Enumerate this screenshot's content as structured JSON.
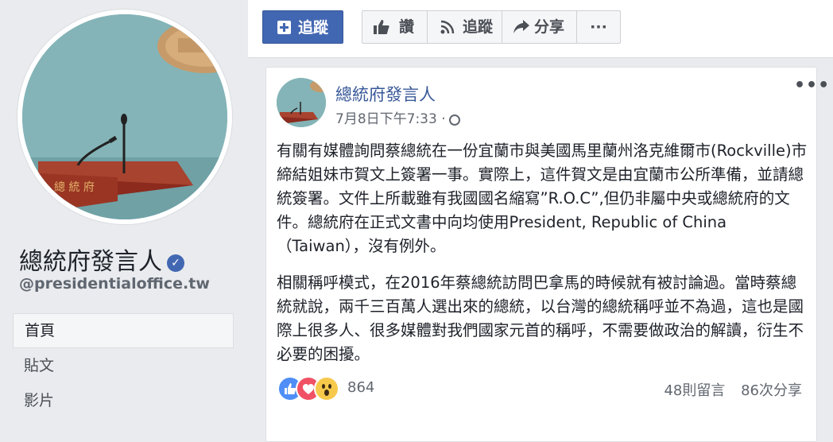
{
  "sidebar": {
    "page_name": "總統府發言人",
    "handle": "@presidentialoffice.tw",
    "nav": [
      {
        "label": "首頁",
        "active": true
      },
      {
        "label": "貼文",
        "active": false
      },
      {
        "label": "影片",
        "active": false
      }
    ]
  },
  "actionbar": {
    "follow_button": "追蹤",
    "like": "讚",
    "follow": "追蹤",
    "share": "分享",
    "more": "···"
  },
  "post": {
    "author": "總統府發言人",
    "timestamp": "7月8日下午7:33 ·",
    "more": "•••",
    "paragraphs": [
      "有關有媒體詢問蔡總統在一份宜蘭市與美國馬里蘭州洛克維爾市(Rockville)市締結姐妹市賀文上簽署一事。實際上，這件賀文是由宜蘭市公所準備，並請總統簽署。文件上所載雖有我國國名縮寫”R.O.C”,但仍非屬中央或總統府的文件。總統府在正式文書中向均使用President, Republic of China（Taiwan），沒有例外。",
      "相關稱呼模式，在2016年蔡總統訪問巴拿馬的時候就有被討論過。當時蔡總統就說，兩千三百萬人選出來的總統，以台灣的總統稱呼並不為過，這也是國際上很多人、很多媒體對我們國家元首的稱呼，不需要做政治的解讀，衍生不必要的困擾。"
    ],
    "reactions": [
      "like",
      "love",
      "wow"
    ],
    "reaction_count": "864",
    "comments": "48則留言",
    "shares": "86次分享"
  },
  "colors": {
    "brand": "#4267b2",
    "link": "#385898",
    "background": "#e9ebee"
  }
}
